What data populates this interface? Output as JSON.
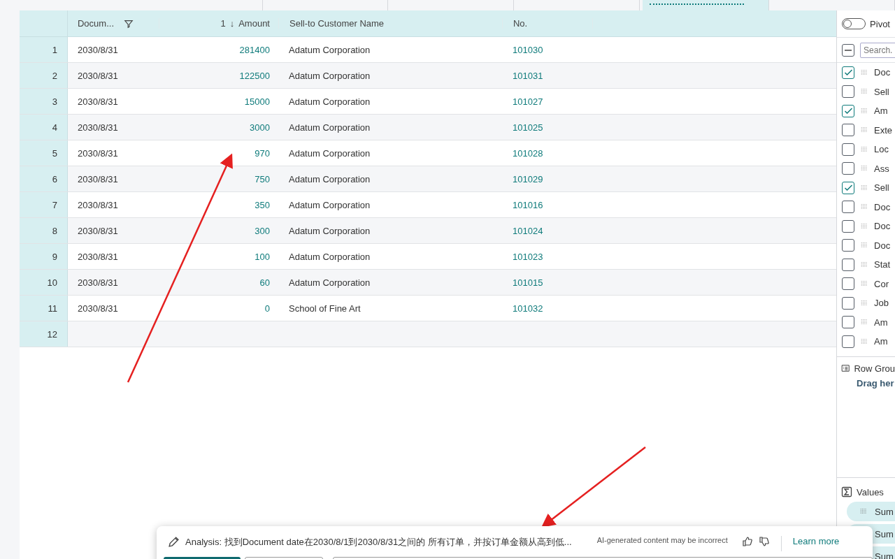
{
  "tabs": [
    {
      "selected": false
    },
    {
      "selected": false
    },
    {
      "selected": false
    },
    {
      "selected": false
    },
    {
      "selected": true
    },
    {
      "selected": false
    }
  ],
  "table": {
    "columns": [
      {
        "label": "Docum...",
        "kind": "filter"
      },
      {
        "label": "Amount",
        "kind": "sort",
        "sort_order": "1",
        "sort_arrow": "↓"
      },
      {
        "label": "Sell-to Customer Name",
        "kind": "plain"
      },
      {
        "label": "No.",
        "kind": "plain"
      }
    ],
    "rows": [
      {
        "num": "1",
        "date": "2030/8/31",
        "amount": "281400",
        "customer": "Adatum Corporation",
        "no": "101030"
      },
      {
        "num": "2",
        "date": "2030/8/31",
        "amount": "122500",
        "customer": "Adatum Corporation",
        "no": "101031"
      },
      {
        "num": "3",
        "date": "2030/8/31",
        "amount": "15000",
        "customer": "Adatum Corporation",
        "no": "101027"
      },
      {
        "num": "4",
        "date": "2030/8/31",
        "amount": "3000",
        "customer": "Adatum Corporation",
        "no": "101025"
      },
      {
        "num": "5",
        "date": "2030/8/31",
        "amount": "970",
        "customer": "Adatum Corporation",
        "no": "101028"
      },
      {
        "num": "6",
        "date": "2030/8/31",
        "amount": "750",
        "customer": "Adatum Corporation",
        "no": "101029"
      },
      {
        "num": "7",
        "date": "2030/8/31",
        "amount": "350",
        "customer": "Adatum Corporation",
        "no": "101016"
      },
      {
        "num": "8",
        "date": "2030/8/31",
        "amount": "300",
        "customer": "Adatum Corporation",
        "no": "101024"
      },
      {
        "num": "9",
        "date": "2030/8/31",
        "amount": "100",
        "customer": "Adatum Corporation",
        "no": "101023"
      },
      {
        "num": "10",
        "date": "2030/8/31",
        "amount": "60",
        "customer": "Adatum Corporation",
        "no": "101015"
      },
      {
        "num": "11",
        "date": "2030/8/31",
        "amount": "0",
        "customer": "School of Fine Art",
        "no": "101032"
      },
      {
        "num": "12"
      }
    ]
  },
  "side_panel": {
    "pivot": {
      "label": "Pivot",
      "on": false
    },
    "select_all": {
      "indeterminate": true
    },
    "search": {
      "placeholder": "Search."
    },
    "fields": [
      {
        "label": "Doc",
        "checked": true
      },
      {
        "label": "Sell",
        "checked": false
      },
      {
        "label": "Am",
        "checked": true
      },
      {
        "label": "Exte",
        "checked": false
      },
      {
        "label": "Loc",
        "checked": false
      },
      {
        "label": "Ass",
        "checked": false
      },
      {
        "label": "Sell",
        "checked": true
      },
      {
        "label": "Doc",
        "checked": false
      },
      {
        "label": "Doc",
        "checked": false
      },
      {
        "label": "Doc",
        "checked": false
      },
      {
        "label": "Stat",
        "checked": false
      },
      {
        "label": "Cor",
        "checked": false
      },
      {
        "label": "Job",
        "checked": false
      },
      {
        "label": "Am",
        "checked": false
      },
      {
        "label": "Am",
        "checked": false
      }
    ],
    "row_groups": {
      "title": "Row Grou",
      "hint": "Drag her"
    },
    "values": {
      "title": "Values",
      "items": [
        "Sum",
        "Sum",
        "Sum"
      ]
    }
  },
  "analysis_bar": {
    "text": "Analysis: 找到Document date在2030/8/1到2030/8/31之间的 所有订单，并按订单金额从高到低...",
    "disclaimer": "AI-generated content may be incorrect",
    "link": "Learn more"
  }
}
